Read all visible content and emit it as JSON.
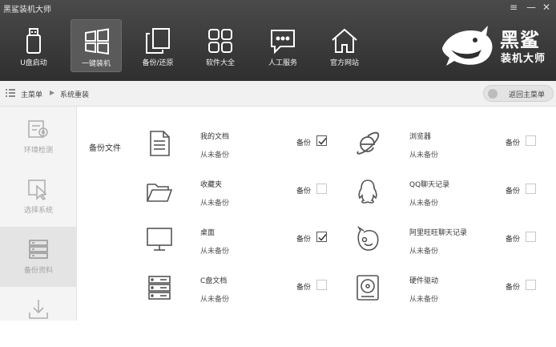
{
  "app_title": "黑鲨装机大师",
  "window_controls": {
    "menu": "≡",
    "minimize": "—",
    "close": "✕"
  },
  "nav": [
    {
      "label": "U盘启动",
      "icon": "usb-drive-icon"
    },
    {
      "label": "一键装机",
      "icon": "windows-logo-icon",
      "active": true
    },
    {
      "label": "备份/还原",
      "icon": "backup-copy-icon"
    },
    {
      "label": "软件大全",
      "icon": "apps-grid-icon"
    },
    {
      "label": "人工服务",
      "icon": "chat-bubble-icon"
    },
    {
      "label": "官方网站",
      "icon": "home-icon"
    }
  ],
  "logo": {
    "line1": "黑鲨",
    "line2": "装机大师",
    "icon": "shark-logo-icon"
  },
  "breadcrumb": {
    "home": "主菜单",
    "separator": "▶",
    "current": "系统重装"
  },
  "back_button": "返回主菜单",
  "sidebar": [
    {
      "label": "环境检测",
      "icon": "environment-check-icon"
    },
    {
      "label": "选择系统",
      "icon": "select-system-icon"
    },
    {
      "label": "备份资料",
      "icon": "backup-data-icon",
      "active": true
    },
    {
      "label": "",
      "icon": "download-icon"
    }
  ],
  "section_label": "备份文件",
  "backup_label": "备份",
  "items": [
    {
      "name": "我的文档",
      "status": "从未备份",
      "checked": true,
      "icon": "document-icon"
    },
    {
      "name": "浏览器",
      "status": "从未备份",
      "checked": false,
      "icon": "ie-browser-icon"
    },
    {
      "name": "收藏夹",
      "status": "从未备份",
      "checked": false,
      "icon": "folder-icon"
    },
    {
      "name": "QQ聊天记录",
      "status": "从未备份",
      "checked": false,
      "icon": "qq-penguin-icon"
    },
    {
      "name": "桌面",
      "status": "从未备份",
      "checked": true,
      "icon": "monitor-icon"
    },
    {
      "name": "阿里旺旺聊天记录",
      "status": "从未备份",
      "checked": false,
      "icon": "aliwangwang-icon"
    },
    {
      "name": "C盘文档",
      "status": "从未备份",
      "checked": false,
      "icon": "server-drive-icon"
    },
    {
      "name": "硬件驱动",
      "status": "从未备份",
      "checked": false,
      "icon": "hard-disk-icon"
    }
  ],
  "colors": {
    "header_bg": "#3a3a3a",
    "sidebar_active": "#e4e4e4",
    "muted_text": "#a3a3a3"
  }
}
